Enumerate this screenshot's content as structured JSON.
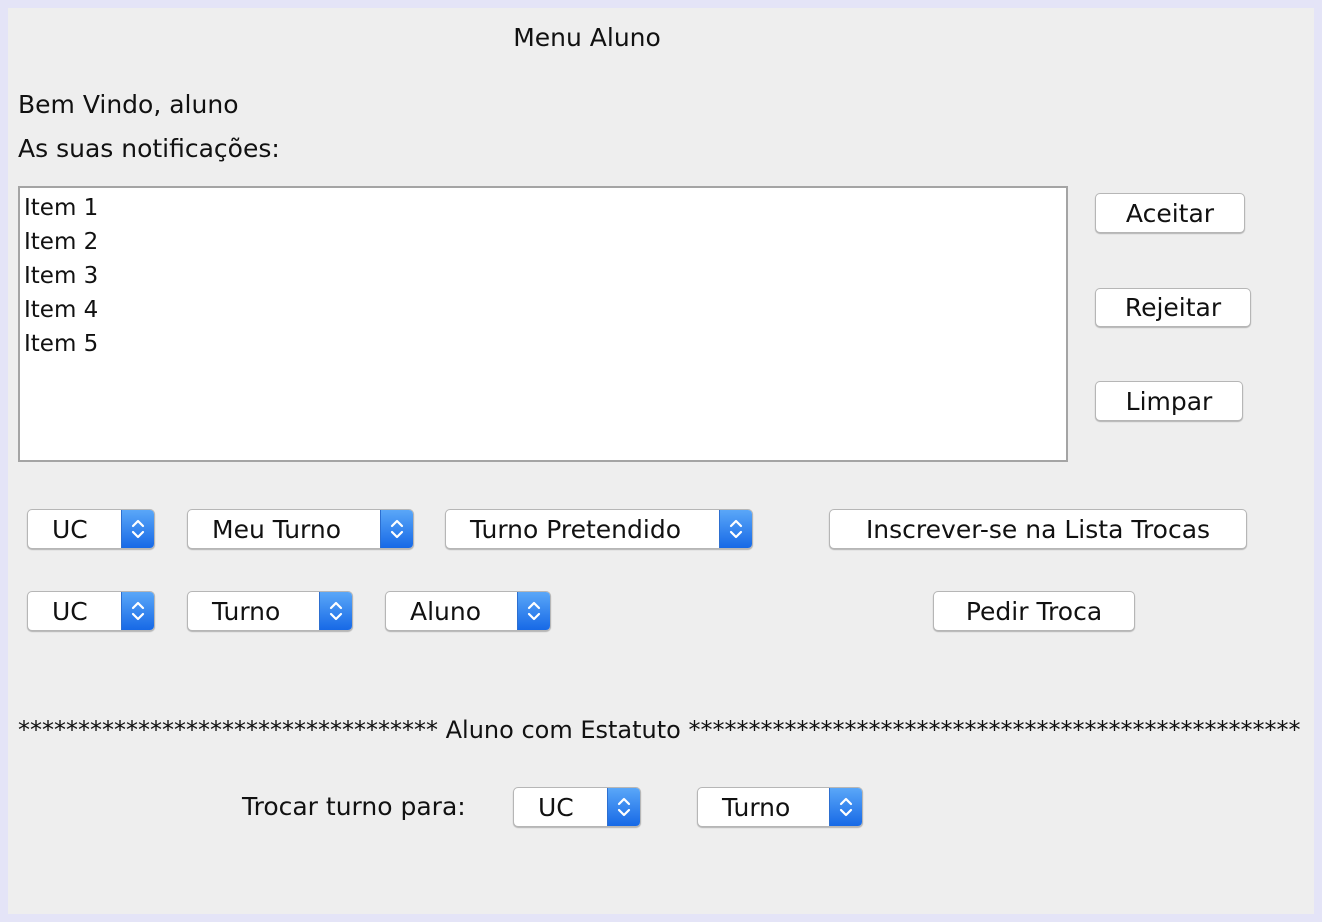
{
  "window": {
    "title": "Menu Aluno"
  },
  "welcome": "Bem Vindo, aluno",
  "notifications_label": "As suas notificações:",
  "notifications": [
    "Item 1",
    "Item 2",
    "Item 3",
    "Item 4",
    "Item 5"
  ],
  "actions": {
    "accept": "Aceitar",
    "reject": "Rejeitar",
    "clear": "Limpar"
  },
  "row1": {
    "uc": "UC",
    "my_shift": "Meu Turno",
    "wanted_shift": "Turno Pretendido",
    "subscribe": "Inscrever-se na Lista Trocas"
  },
  "row2": {
    "uc": "UC",
    "shift": "Turno",
    "student": "Aluno",
    "request": "Pedir Troca"
  },
  "status_divider": "*********************************** Aluno com Estatuto ***************************************************",
  "status_section": {
    "change_label": "Trocar turno para:",
    "uc": "UC",
    "shift": "Turno"
  },
  "colors": {
    "accent": "#1769e6",
    "background": "#eeeeee"
  },
  "icons": {
    "combo_arrow": "updown-chevron-icon"
  }
}
